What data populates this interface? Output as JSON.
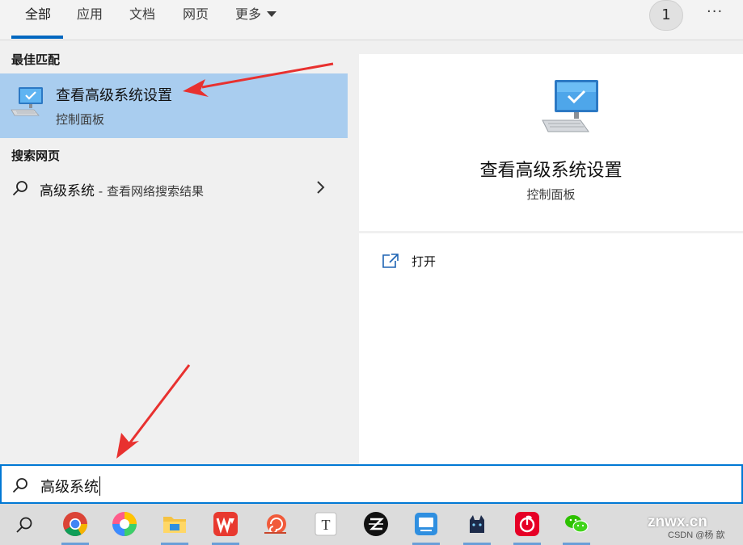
{
  "tabs": [
    {
      "label": "全部",
      "active": true
    },
    {
      "label": "应用",
      "active": false
    },
    {
      "label": "文档",
      "active": false
    },
    {
      "label": "网页",
      "active": false
    },
    {
      "label": "更多",
      "active": false
    }
  ],
  "badge_count": "1",
  "more_options_label": "···",
  "best_match": {
    "section_title": "最佳匹配",
    "title": "查看高级系统设置",
    "subtitle": "控制面板",
    "icon": "computer-settings-icon"
  },
  "web_search": {
    "section_title": "搜索网页",
    "query": "高级系统",
    "suffix": " - 查看网络搜索结果",
    "icon": "search-icon"
  },
  "detail": {
    "title": "查看高级系统设置",
    "subtitle": "控制面板",
    "open_label": "打开",
    "icon": "computer-settings-icon"
  },
  "search": {
    "value": "高级系统",
    "icon": "search-icon"
  },
  "taskbar": {
    "apps": [
      "chrome-icon",
      "photos-icon",
      "file-explorer-icon",
      "wps-office-icon",
      "snail-app-icon",
      "typora-icon",
      "zhihu-icon",
      "screen-app-icon",
      "cat-app-icon",
      "netease-music-icon",
      "wechat-icon"
    ]
  },
  "watermark": {
    "main": "znwx.cn",
    "sub": "CSDN @杨 歆"
  },
  "colors": {
    "accent": "#0078d4",
    "highlight": "#a9cdef",
    "annotation_arrow": "#e8312f"
  }
}
